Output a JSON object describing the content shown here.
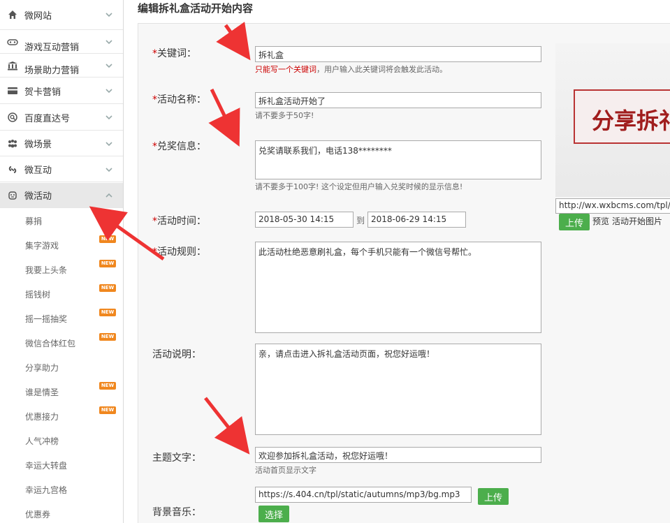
{
  "sidebar": {
    "menus": [
      {
        "label": "微网站",
        "icon": "home-icon"
      },
      {
        "label": "游戏互动营销",
        "icon": "gamepad-icon"
      },
      {
        "label": "场景助力营销",
        "icon": "bank-icon"
      },
      {
        "label": "贺卡营销",
        "icon": "card-icon"
      },
      {
        "label": "百度直达号",
        "icon": "search-circle-icon"
      },
      {
        "label": "微场景",
        "icon": "paw-icon"
      },
      {
        "label": "微互动",
        "icon": "link-icon"
      },
      {
        "label": "微活动",
        "icon": "face-icon"
      }
    ],
    "subitems": [
      {
        "label": "募捐",
        "new": true
      },
      {
        "label": "集字游戏",
        "new": true
      },
      {
        "label": "我要上头条",
        "new": true
      },
      {
        "label": "摇钱树",
        "new": true
      },
      {
        "label": "摇一摇抽奖",
        "new": true
      },
      {
        "label": "微信合体红包",
        "new": true
      },
      {
        "label": "分享助力",
        "new": false
      },
      {
        "label": "谁是情圣",
        "new": true
      },
      {
        "label": "优惠接力",
        "new": true
      },
      {
        "label": "人气冲榜",
        "new": false
      },
      {
        "label": "幸运大转盘",
        "new": false
      },
      {
        "label": "幸运九宫格",
        "new": false
      },
      {
        "label": "优惠券",
        "new": false
      }
    ],
    "new_badge": "NEW"
  },
  "page": {
    "title": "编辑拆礼盒活动开始内容"
  },
  "form": {
    "keyword": {
      "label": "关键词：",
      "value": "拆礼盒",
      "hint_red": "只能写一个关键词",
      "hint": "，用户输入此关键词将会触发此活动。"
    },
    "name": {
      "label": "活动名称：",
      "value": "拆礼盒活动开始了",
      "hint": "请不要多于50字!"
    },
    "prize": {
      "label": "兑奖信息：",
      "value": "兑奖请联系我们，电话138********",
      "hint": "请不要多于100字! 这个设定但用户输入兑奖时候的显示信息!"
    },
    "time": {
      "label": "活动时间：",
      "start": "2018-05-30 14:15",
      "to": "到",
      "end": "2018-06-29 14:15"
    },
    "rules": {
      "label": "活动规则：",
      "value": "此活动杜绝恶意刷礼盒，每个手机只能有一个微信号帮忙。"
    },
    "desc": {
      "label": "活动说明：",
      "value": "亲，请点击进入拆礼盒活动页面，祝您好运哦！"
    },
    "theme": {
      "label": "主题文字：",
      "value": "欢迎参加拆礼盒活动，祝您好运哦！",
      "hint": "活动首页显示文字"
    },
    "music": {
      "label": "背景音乐：",
      "value": "https://s.404.cn/tpl/static/autumns/mp3/bg.mp3",
      "upload": "上传",
      "select": "选择"
    },
    "required_mark": "*"
  },
  "preview": {
    "banner_text": "分享拆礼",
    "url": "http://wx.wxbcms.com/tpl/static",
    "upload": "上传",
    "preview_link": "预览",
    "caption": "活动开始图片"
  },
  "colors": {
    "accent_green": "#4cae4c",
    "required_red": "#cc0000",
    "arrow_red": "#ee3333",
    "new_badge": "#f0871e"
  }
}
